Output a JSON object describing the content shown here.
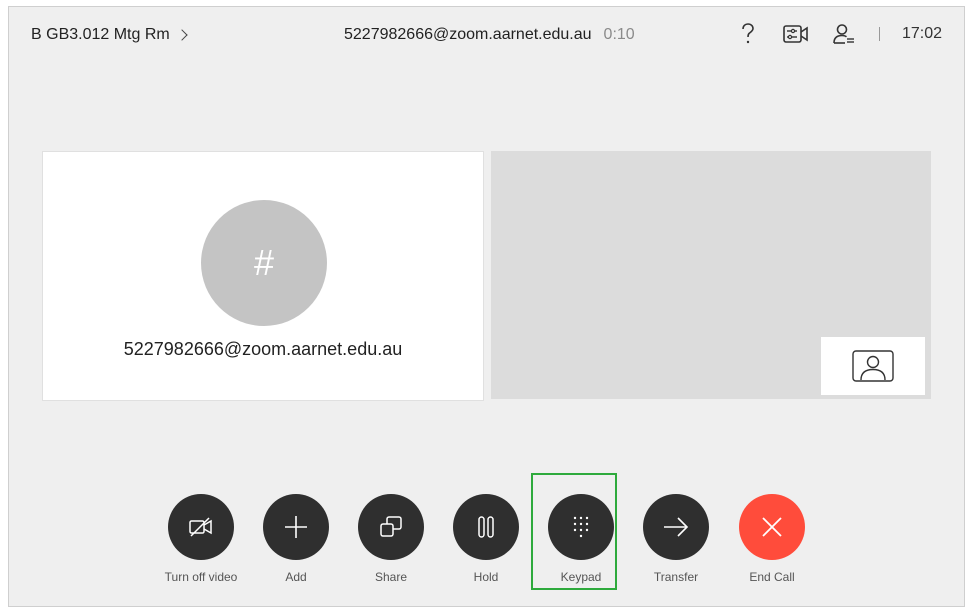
{
  "header": {
    "room_name": "B GB3.012 Mtg Rm",
    "call_address": "5227982666@zoom.aarnet.edu.au",
    "call_duration": "0:10",
    "time": "17:02",
    "icons": [
      "help-icon",
      "camera-settings-icon",
      "participants-icon"
    ]
  },
  "remote_tile": {
    "avatar_symbol": "#",
    "name": "5227982666@zoom.aarnet.edu.au"
  },
  "controls": [
    {
      "name": "turn-off-video-button",
      "label": "Turn off video",
      "icon": "video-off-icon"
    },
    {
      "name": "add-button",
      "label": "Add",
      "icon": "plus-icon"
    },
    {
      "name": "share-button",
      "label": "Share",
      "icon": "share-icon"
    },
    {
      "name": "hold-button",
      "label": "Hold",
      "icon": "pause-icon"
    },
    {
      "name": "keypad-button",
      "label": "Keypad",
      "icon": "keypad-icon",
      "highlighted": true
    },
    {
      "name": "transfer-button",
      "label": "Transfer",
      "icon": "arrow-right-icon"
    },
    {
      "name": "end-call-button",
      "label": "End Call",
      "icon": "close-icon",
      "color": "#ff4c3b"
    }
  ]
}
